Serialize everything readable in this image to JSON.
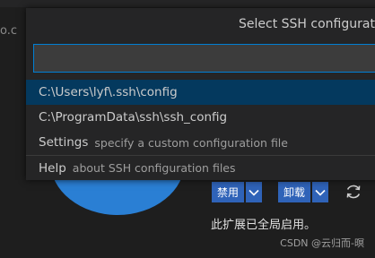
{
  "background": {
    "tab_fragment": "o.c",
    "buttons": {
      "disable_label": "禁用",
      "uninstall_label": "卸载"
    },
    "status_text": "此扩展已全局启用。",
    "watermark": "CSDN @云归而-暝"
  },
  "quick_pick": {
    "title": "Select SSH configurat",
    "input_value": "",
    "items": [
      {
        "label": "C:\\Users\\lyf\\.ssh\\config",
        "description": ""
      },
      {
        "label": "C:\\ProgramData\\ssh\\ssh_config",
        "description": ""
      },
      {
        "label": "Settings",
        "description": "specify a custom configuration file"
      },
      {
        "label": "Help",
        "description": "about SSH configuration files"
      }
    ]
  },
  "colors": {
    "accent_button": "#2f63b8",
    "focus_border": "#007fd4",
    "active_item": "#04395e",
    "avatar": "#2a7fd4"
  },
  "icons": [
    "chevron-down-icon",
    "sync-icon"
  ]
}
